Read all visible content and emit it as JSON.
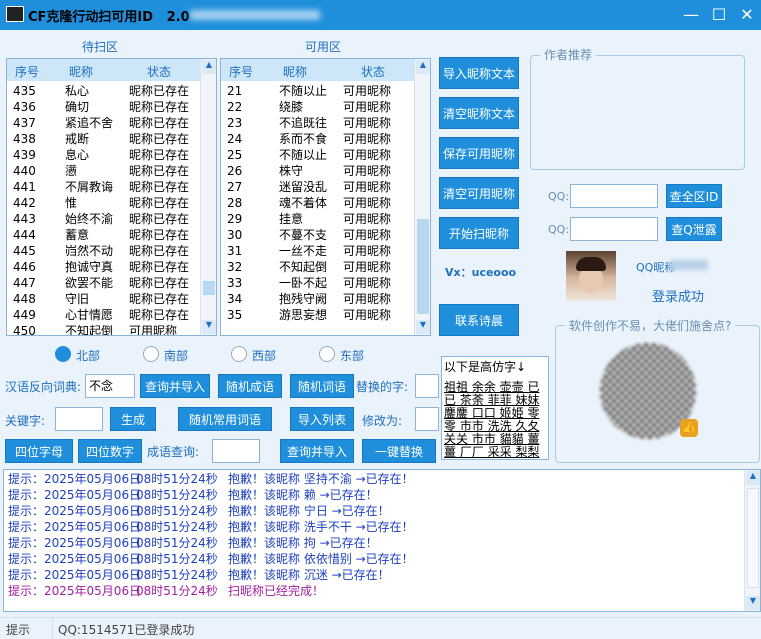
{
  "title": "CF克隆行动扫可用ID",
  "version": "2.0",
  "waitlist": {
    "label": "待扫区",
    "headers": [
      "序号",
      "昵称",
      "状态"
    ],
    "rows": [
      [
        "435",
        "私心",
        "昵称已存在"
      ],
      [
        "436",
        "确切",
        "昵称已存在"
      ],
      [
        "437",
        "紧追不舍",
        "昵称已存在"
      ],
      [
        "438",
        "戒断",
        "昵称已存在"
      ],
      [
        "439",
        "息心",
        "昵称已存在"
      ],
      [
        "440",
        "懑",
        "昵称已存在"
      ],
      [
        "441",
        "不屑教诲",
        "昵称已存在"
      ],
      [
        "442",
        "惟",
        "昵称已存在"
      ],
      [
        "443",
        "始终不渝",
        "昵称已存在"
      ],
      [
        "444",
        "蓄意",
        "昵称已存在"
      ],
      [
        "445",
        "岿然不动",
        "昵称已存在"
      ],
      [
        "446",
        "抱诚守真",
        "昵称已存在"
      ],
      [
        "447",
        "欲罢不能",
        "昵称已存在"
      ],
      [
        "448",
        "守旧",
        "昵称已存在"
      ],
      [
        "449",
        "心甘情愿",
        "昵称已存在"
      ],
      [
        "450",
        "不知起倒",
        "可用昵称"
      ]
    ]
  },
  "availlist": {
    "label": "可用区",
    "headers": [
      "序号",
      "昵称",
      "状态"
    ],
    "rows": [
      [
        "21",
        "不随以止",
        "可用昵称"
      ],
      [
        "22",
        "绕膝",
        "可用昵称"
      ],
      [
        "23",
        "不追既往",
        "可用昵称"
      ],
      [
        "24",
        "系而不食",
        "可用昵称"
      ],
      [
        "25",
        "不随以止",
        "可用昵称"
      ],
      [
        "26",
        "株守",
        "可用昵称"
      ],
      [
        "27",
        "迷留没乱",
        "可用昵称"
      ],
      [
        "28",
        "魂不着体",
        "可用昵称"
      ],
      [
        "29",
        "挂意",
        "可用昵称"
      ],
      [
        "30",
        "不蔓不支",
        "可用昵称"
      ],
      [
        "31",
        "一丝不走",
        "可用昵称"
      ],
      [
        "32",
        "不知起倒",
        "可用昵称"
      ],
      [
        "33",
        "一卧不起",
        "可用昵称"
      ],
      [
        "34",
        "抱残守阙",
        "可用昵称"
      ],
      [
        "35",
        "游思妄想",
        "可用昵称"
      ]
    ]
  },
  "actions": {
    "import_nick": "导入昵称文本",
    "clear_nick": "清空昵称文本",
    "save_avail": "保存可用昵称",
    "clear_avail": "清空可用昵称",
    "start_scan": "开始扫昵称",
    "vx": "Vx：uceooo",
    "contact": "联系诗晨"
  },
  "recommend": {
    "label": "作者推荐"
  },
  "qq": {
    "label1": "QQ:",
    "label2": "QQ:",
    "btn_check_id": "查全区ID",
    "btn_check_leak": "查Q泄露",
    "nick_label": "QQ昵称",
    "login_status": "登录成功"
  },
  "donate": {
    "label": "软件创作不易，大佬们施舍点?"
  },
  "regions": [
    "北部",
    "南部",
    "西部",
    "东部"
  ],
  "controls": {
    "reverse_label": "汉语反向词典:",
    "reverse_value": "不念",
    "query_import": "查询并导入",
    "random_idiom": "随机成语",
    "random_word": "随机词语",
    "replace_label": "替换的字:",
    "keyword_label": "关键字:",
    "generate": "生成",
    "random_common": "随机常用词语",
    "import_list": "导入列表",
    "modify_label": "修改为:",
    "four_letters": "四位字母",
    "four_digits": "四位数字",
    "idiom_query_label": "成语查询:",
    "query_import2": "查询并导入",
    "one_key_replace": "一键替换"
  },
  "homoglyph": {
    "title": "以下是高仿字↓",
    "lines": [
      "祖祖 余余 壶壸 已",
      "已 茶荼 菲菲 妹妺",
      "鏖鏖 口口 姬姫 零",
      "零 市市 洗洗 久夂",
      "关关 市市 貓貓 薑",
      "薑 厂厂 采采 梨梨"
    ]
  },
  "log": {
    "lines": [
      [
        "提示：",
        "2025年05月06日",
        "08时51分24秒",
        "抱歉！该昵称 坚持不渝 →已存在！"
      ],
      [
        "提示：",
        "2025年05月06日",
        "08时51分24秒",
        "抱歉！该昵称 赖 →已存在！"
      ],
      [
        "提示：",
        "2025年05月06日",
        "08时51分24秒",
        "抱歉！该昵称 宁日 →已存在！"
      ],
      [
        "提示：",
        "2025年05月06日",
        "08时51分24秒",
        "抱歉！该昵称 洗手不干 →已存在！"
      ],
      [
        "提示：",
        "2025年05月06日",
        "08时51分24秒",
        "抱歉！该昵称 拘 →已存在！"
      ],
      [
        "提示：",
        "2025年05月06日",
        "08时51分24秒",
        "抱歉！该昵称 依依惜别 →已存在！"
      ],
      [
        "提示：",
        "2025年05月06日",
        "08时51分24秒",
        "抱歉！该昵称 沉迷 →已存在！"
      ],
      [
        "提示：",
        "2025年05月06日",
        "08时51分24秒",
        "扫昵称已经完成！"
      ]
    ]
  },
  "status": {
    "left": "提示",
    "right": "QQ:1514571已登录成功"
  },
  "colors": {
    "accent": "#1f8fdc",
    "log_text": "#1e3fbf",
    "log_done": "#a020a0"
  }
}
